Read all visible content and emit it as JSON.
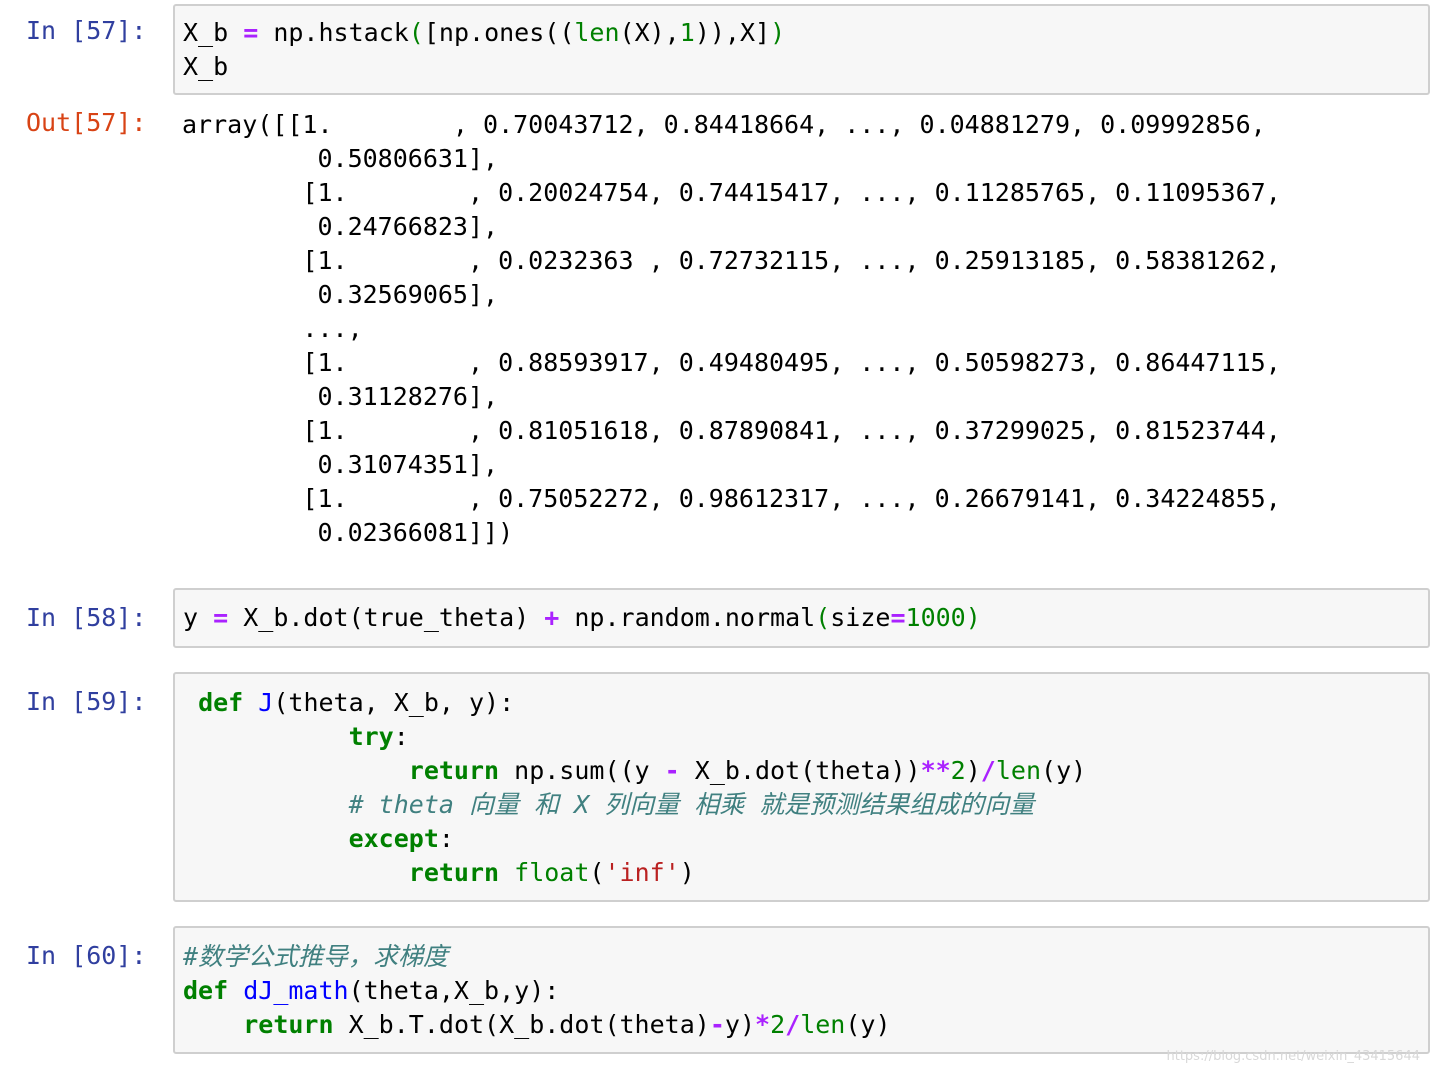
{
  "cells": [
    {
      "prompt": "In [57]:",
      "lines": [
        [
          {
            "t": "X_b ",
            "c": ""
          },
          {
            "t": "=",
            "c": "op"
          },
          {
            "t": " np.hstack",
            "c": ""
          },
          {
            "t": "(",
            "c": "bi"
          },
          {
            "t": "[np.ones((",
            "c": ""
          },
          {
            "t": "len",
            "c": "bi"
          },
          {
            "t": "(X),",
            "c": ""
          },
          {
            "t": "1",
            "c": "num"
          },
          {
            "t": ")),X]",
            "c": ""
          },
          {
            "t": ")",
            "c": "bi"
          }
        ],
        [
          {
            "t": "X_b",
            "c": ""
          }
        ]
      ]
    },
    {
      "prompt": "Out[57]:",
      "output": "array([[1.        , 0.70043712, 0.84418664, ..., 0.04881279, 0.09992856,\n         0.50806631],\n        [1.        , 0.20024754, 0.74415417, ..., 0.11285765, 0.11095367,\n         0.24766823],\n        [1.        , 0.0232363 , 0.72732115, ..., 0.25913185, 0.58381262,\n         0.32569065],\n        ...,\n        [1.        , 0.88593917, 0.49480495, ..., 0.50598273, 0.86447115,\n         0.31128276],\n        [1.        , 0.81051618, 0.87890841, ..., 0.37299025, 0.81523744,\n         0.31074351],\n        [1.        , 0.75052272, 0.98612317, ..., 0.26679141, 0.34224855,\n         0.02366081]])"
    },
    {
      "prompt": "In [58]:",
      "lines": [
        [
          {
            "t": "y ",
            "c": ""
          },
          {
            "t": "=",
            "c": "op"
          },
          {
            "t": " X_b.dot(true_theta) ",
            "c": ""
          },
          {
            "t": "+",
            "c": "op"
          },
          {
            "t": " np.random.normal",
            "c": ""
          },
          {
            "t": "(",
            "c": "bi"
          },
          {
            "t": "size",
            "c": ""
          },
          {
            "t": "=",
            "c": "op"
          },
          {
            "t": "1000",
            "c": "num"
          },
          {
            "t": ")",
            "c": "bi"
          }
        ]
      ]
    },
    {
      "prompt": "In [59]:",
      "lines": [
        [
          {
            "t": " ",
            "c": ""
          },
          {
            "t": "def",
            "c": "kw"
          },
          {
            "t": " ",
            "c": ""
          },
          {
            "t": "J",
            "c": "fn"
          },
          {
            "t": "(theta, X_b, y):",
            "c": ""
          }
        ],
        [
          {
            "t": "           ",
            "c": ""
          },
          {
            "t": "try",
            "c": "kw"
          },
          {
            "t": ":",
            "c": ""
          }
        ],
        [
          {
            "t": "               ",
            "c": ""
          },
          {
            "t": "return",
            "c": "kw"
          },
          {
            "t": " np.sum((y ",
            "c": ""
          },
          {
            "t": "-",
            "c": "op"
          },
          {
            "t": " X_b.dot(theta))",
            "c": ""
          },
          {
            "t": "**",
            "c": "op"
          },
          {
            "t": "2",
            "c": "num"
          },
          {
            "t": ")",
            "c": ""
          },
          {
            "t": "/",
            "c": "op"
          },
          {
            "t": "len",
            "c": "bi"
          },
          {
            "t": "(y)",
            "c": ""
          }
        ],
        [
          {
            "t": "           ",
            "c": ""
          },
          {
            "t": "# theta 向量 和 X 列向量 相乘 就是预测结果组成的向量",
            "c": "cm"
          }
        ],
        [
          {
            "t": "           ",
            "c": ""
          },
          {
            "t": "except",
            "c": "kw"
          },
          {
            "t": ":",
            "c": ""
          }
        ],
        [
          {
            "t": "               ",
            "c": ""
          },
          {
            "t": "return",
            "c": "kw"
          },
          {
            "t": " ",
            "c": ""
          },
          {
            "t": "float",
            "c": "bi"
          },
          {
            "t": "(",
            "c": ""
          },
          {
            "t": "'inf'",
            "c": "str"
          },
          {
            "t": ")",
            "c": ""
          }
        ]
      ]
    },
    {
      "prompt": "In [60]:",
      "lines": [
        [
          {
            "t": "#数学公式推导，求梯度",
            "c": "cm"
          }
        ],
        [
          {
            "t": "def",
            "c": "kw"
          },
          {
            "t": " ",
            "c": ""
          },
          {
            "t": "dJ_math",
            "c": "fn"
          },
          {
            "t": "(theta,X_b,y):",
            "c": ""
          }
        ],
        [
          {
            "t": "    ",
            "c": ""
          },
          {
            "t": "return",
            "c": "kw"
          },
          {
            "t": " X_b.T.dot(X_b.dot(theta)",
            "c": ""
          },
          {
            "t": "-",
            "c": "op"
          },
          {
            "t": "y)",
            "c": ""
          },
          {
            "t": "*",
            "c": "op"
          },
          {
            "t": "2",
            "c": "num"
          },
          {
            "t": "/",
            "c": "op"
          },
          {
            "t": "len",
            "c": "bi"
          },
          {
            "t": "(y)",
            "c": ""
          }
        ]
      ]
    }
  ],
  "watermark": "https://blog.csdn.net/weixin_43415644"
}
